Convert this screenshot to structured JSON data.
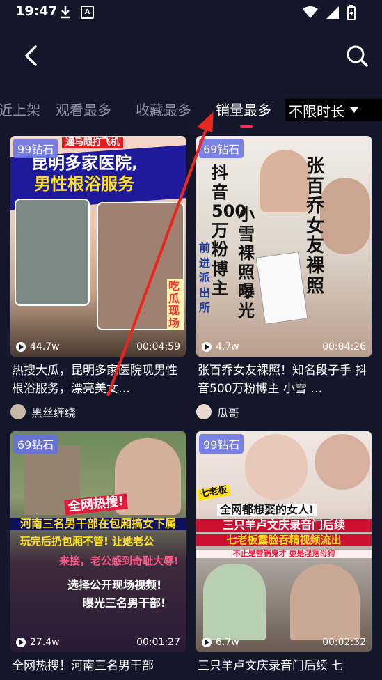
{
  "status_bar": {
    "time": "19:47",
    "a_icon": "A"
  },
  "tabs": [
    {
      "label": "近上架"
    },
    {
      "label": "观看最多"
    },
    {
      "label": "收藏最多"
    },
    {
      "label": "销量最多",
      "active": true
    }
  ],
  "filter": {
    "selected": "不限时长"
  },
  "cards": [
    {
      "badge": "99钻石",
      "views": "44.7w",
      "duration": "00:04:59",
      "title": "热搜大瓜，昆明多家医院现男性根浴服务，漂亮美女…",
      "author": "黑丝缠绕",
      "overlay": {
        "line1": "昆明多家医院,",
        "line2": "男性根浴服务",
        "tag": "通马眼打飞机",
        "corner": "吃瓜现场"
      }
    },
    {
      "badge": "69钻石",
      "views": "4.7w",
      "duration": "00:04:26",
      "title": "张百乔女友裸照！知名段子手 抖音500万粉博主 小雪 …",
      "author": "瓜哥",
      "overlay": {
        "v1": "抖音500万粉博主",
        "v2": "小雪裸照曝光",
        "v3": "张百乔女友裸照",
        "v4": "前进派出所"
      }
    },
    {
      "badge": "69钻石",
      "views": "27.4w",
      "duration": "00:01:27",
      "title": "全网热搜！河南三名男干部",
      "author": "",
      "overlay": {
        "l1": "全网热搜!",
        "l2": "河南三名男干部在包厢搞女下属",
        "l3": "玩完后扔包厢不管! 让她老公",
        "l4": "来接，老公感到奇耻大辱!",
        "l5": "选择公开现场视频!",
        "l6": "曝光三名男干部!"
      }
    },
    {
      "badge": "99钻石",
      "views": "6.7w",
      "duration": "00:02:32",
      "title": "三只羊卢文庆录音门后续 七",
      "author": "",
      "overlay": {
        "l0": "七老板",
        "l1": "全网都想娶的女人!",
        "l2": "三只羊卢文庆录音门后续",
        "l3": "七老板露脸吞精视频流出",
        "l4": "不止是营销鬼才 更是淫荡母狗"
      }
    }
  ]
}
